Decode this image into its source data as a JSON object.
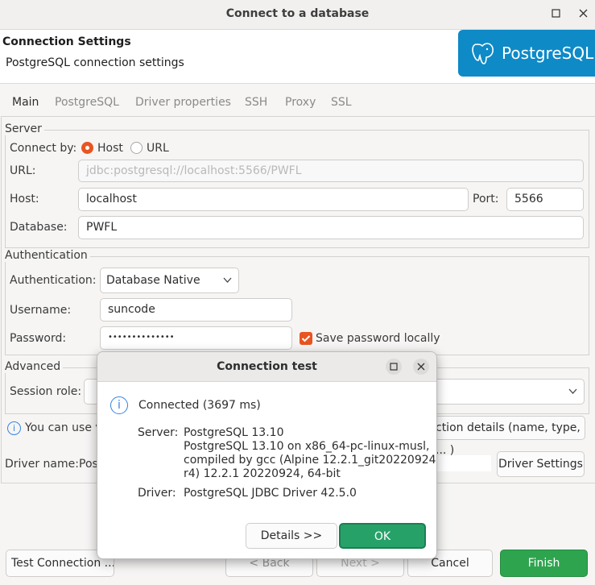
{
  "window": {
    "title": "Connect to a database"
  },
  "header": {
    "title": "Connection Settings",
    "subtitle": "PostgreSQL connection settings",
    "logo_text": "PostgreSQL"
  },
  "tabs": [
    {
      "label": "Main",
      "active": true
    },
    {
      "label": "PostgreSQL",
      "active": false
    },
    {
      "label": "Driver properties",
      "active": false
    },
    {
      "label": "SSH",
      "active": false
    },
    {
      "label": "Proxy",
      "active": false
    },
    {
      "label": "SSL",
      "active": false
    }
  ],
  "server": {
    "legend": "Server",
    "connect_by_label": "Connect by:",
    "host_option": "Host",
    "url_option": "URL",
    "selected": "Host",
    "url_label": "URL:",
    "url_value": "jdbc:postgresql://localhost:5566/PWFL",
    "host_label": "Host:",
    "host_value": "localhost",
    "port_label": "Port:",
    "port_value": "5566",
    "database_label": "Database:",
    "database_value": "PWFL"
  },
  "auth": {
    "legend": "Authentication",
    "auth_label": "Authentication:",
    "auth_value": "Database Native",
    "username_label": "Username:",
    "username_value": "suncode",
    "password_label": "Password:",
    "password_value": "••••••••••••••",
    "save_password_label": "Save password locally",
    "save_password_checked": true
  },
  "advanced": {
    "legend": "Advanced",
    "session_role_label": "Session role:"
  },
  "info_line": {
    "left_text": "You can use va",
    "right_text": "ction details (name, type, ... )"
  },
  "driver": {
    "label": "Driver name:",
    "value_partial": "Pos",
    "settings_button": "Driver Settings"
  },
  "footer": {
    "test_connection": "Test Connection ...",
    "back": "< Back",
    "next": "Next >",
    "cancel": "Cancel",
    "finish": "Finish"
  },
  "dialog": {
    "title": "Connection test",
    "status": "Connected (3697 ms)",
    "server_label": "Server:",
    "server_lines": [
      "PostgreSQL 13.10",
      "PostgreSQL 13.10 on x86_64-pc-linux-musl,",
      "compiled by gcc (Alpine 12.2.1_git20220924-",
      "r4) 12.2.1 20220924, 64-bit"
    ],
    "driver_label": "Driver:",
    "driver_value": "PostgreSQL JDBC Driver 42.5.0",
    "details_button": "Details >>",
    "ok_button": "OK"
  },
  "colors": {
    "accent_orange": "#e95420",
    "ok_green": "#26a269",
    "finish_green": "#2ea44f",
    "logo_blue": "#0e8ac7",
    "info_blue": "#3584e4"
  }
}
